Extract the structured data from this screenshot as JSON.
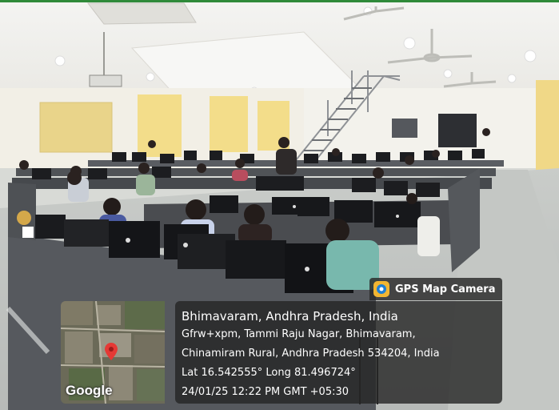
{
  "scene": {
    "description_icons": [
      "ceiling-fan-icon",
      "ceiling-light-icon",
      "staircase",
      "monitor-icon"
    ]
  },
  "overlay": {
    "badge_label": "GPS Map Camera",
    "location_title": "Bhimavaram, Andhra Pradesh, India",
    "address_line1": "Gfrw+xpm, Tammi Raju Nagar, Bhimavaram,",
    "address_line2": "Chinamiram Rural, Andhra Pradesh 534204, India",
    "coordinates": "Lat 16.542555° Long 81.496724°",
    "timestamp": "24/01/25 12:22 PM GMT +05:30",
    "map_brand": "Google"
  },
  "colors": {
    "wall": "#f2efe6",
    "wall_yellow": "#f3dd8a",
    "partition": "#4a4c50",
    "monitor": "#1b1c1f",
    "floor": "#cfd2cf",
    "panel_bg": "#262626",
    "pin": "#e53935"
  }
}
